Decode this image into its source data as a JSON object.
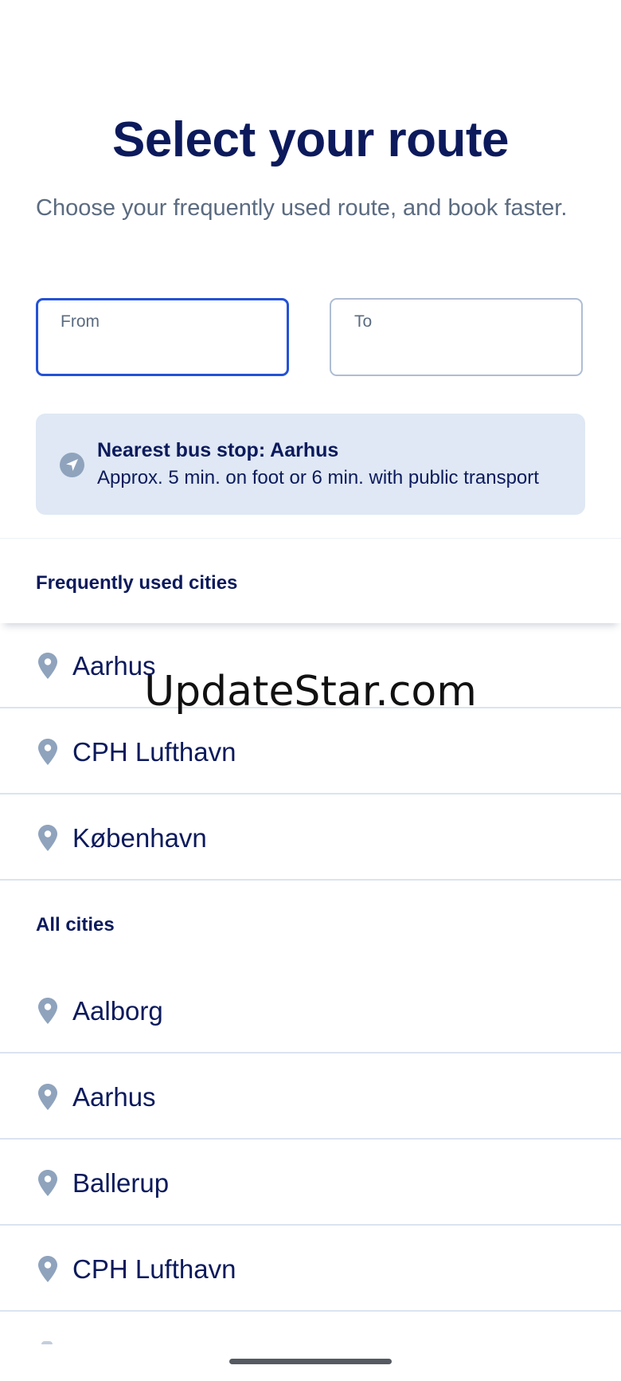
{
  "page": {
    "title": "Select your route",
    "subtitle": "Choose your frequently used route, and book faster."
  },
  "route_form": {
    "from_label": "From",
    "from_value": "",
    "to_label": "To",
    "to_value": ""
  },
  "nearest_stop": {
    "icon": "navigation-arrow-icon",
    "heading": "Nearest bus stop: Aarhus",
    "description": "Approx. 5 min. on foot or 6 min. with public transport"
  },
  "frequent_cities": {
    "header": "Frequently used cities",
    "items": [
      {
        "name": "Aarhus",
        "icon": "location-pin-icon"
      },
      {
        "name": "CPH Lufthavn",
        "icon": "location-pin-icon"
      },
      {
        "name": "København",
        "icon": "location-pin-icon"
      }
    ]
  },
  "all_cities": {
    "header": "All cities",
    "items": [
      {
        "name": "Aalborg",
        "icon": "location-pin-icon"
      },
      {
        "name": "Aarhus",
        "icon": "location-pin-icon"
      },
      {
        "name": "Ballerup",
        "icon": "location-pin-icon"
      },
      {
        "name": "CPH Lufthavn",
        "icon": "location-pin-icon"
      }
    ]
  },
  "watermark": "UpdateStar.com",
  "colors": {
    "primary_text": "#0c1a5c",
    "secondary_text": "#5b6b80",
    "focus_border": "#2452d6",
    "info_background": "#dfe8f4",
    "pin": "#8fa3bd",
    "divider": "#dbe4f0"
  }
}
